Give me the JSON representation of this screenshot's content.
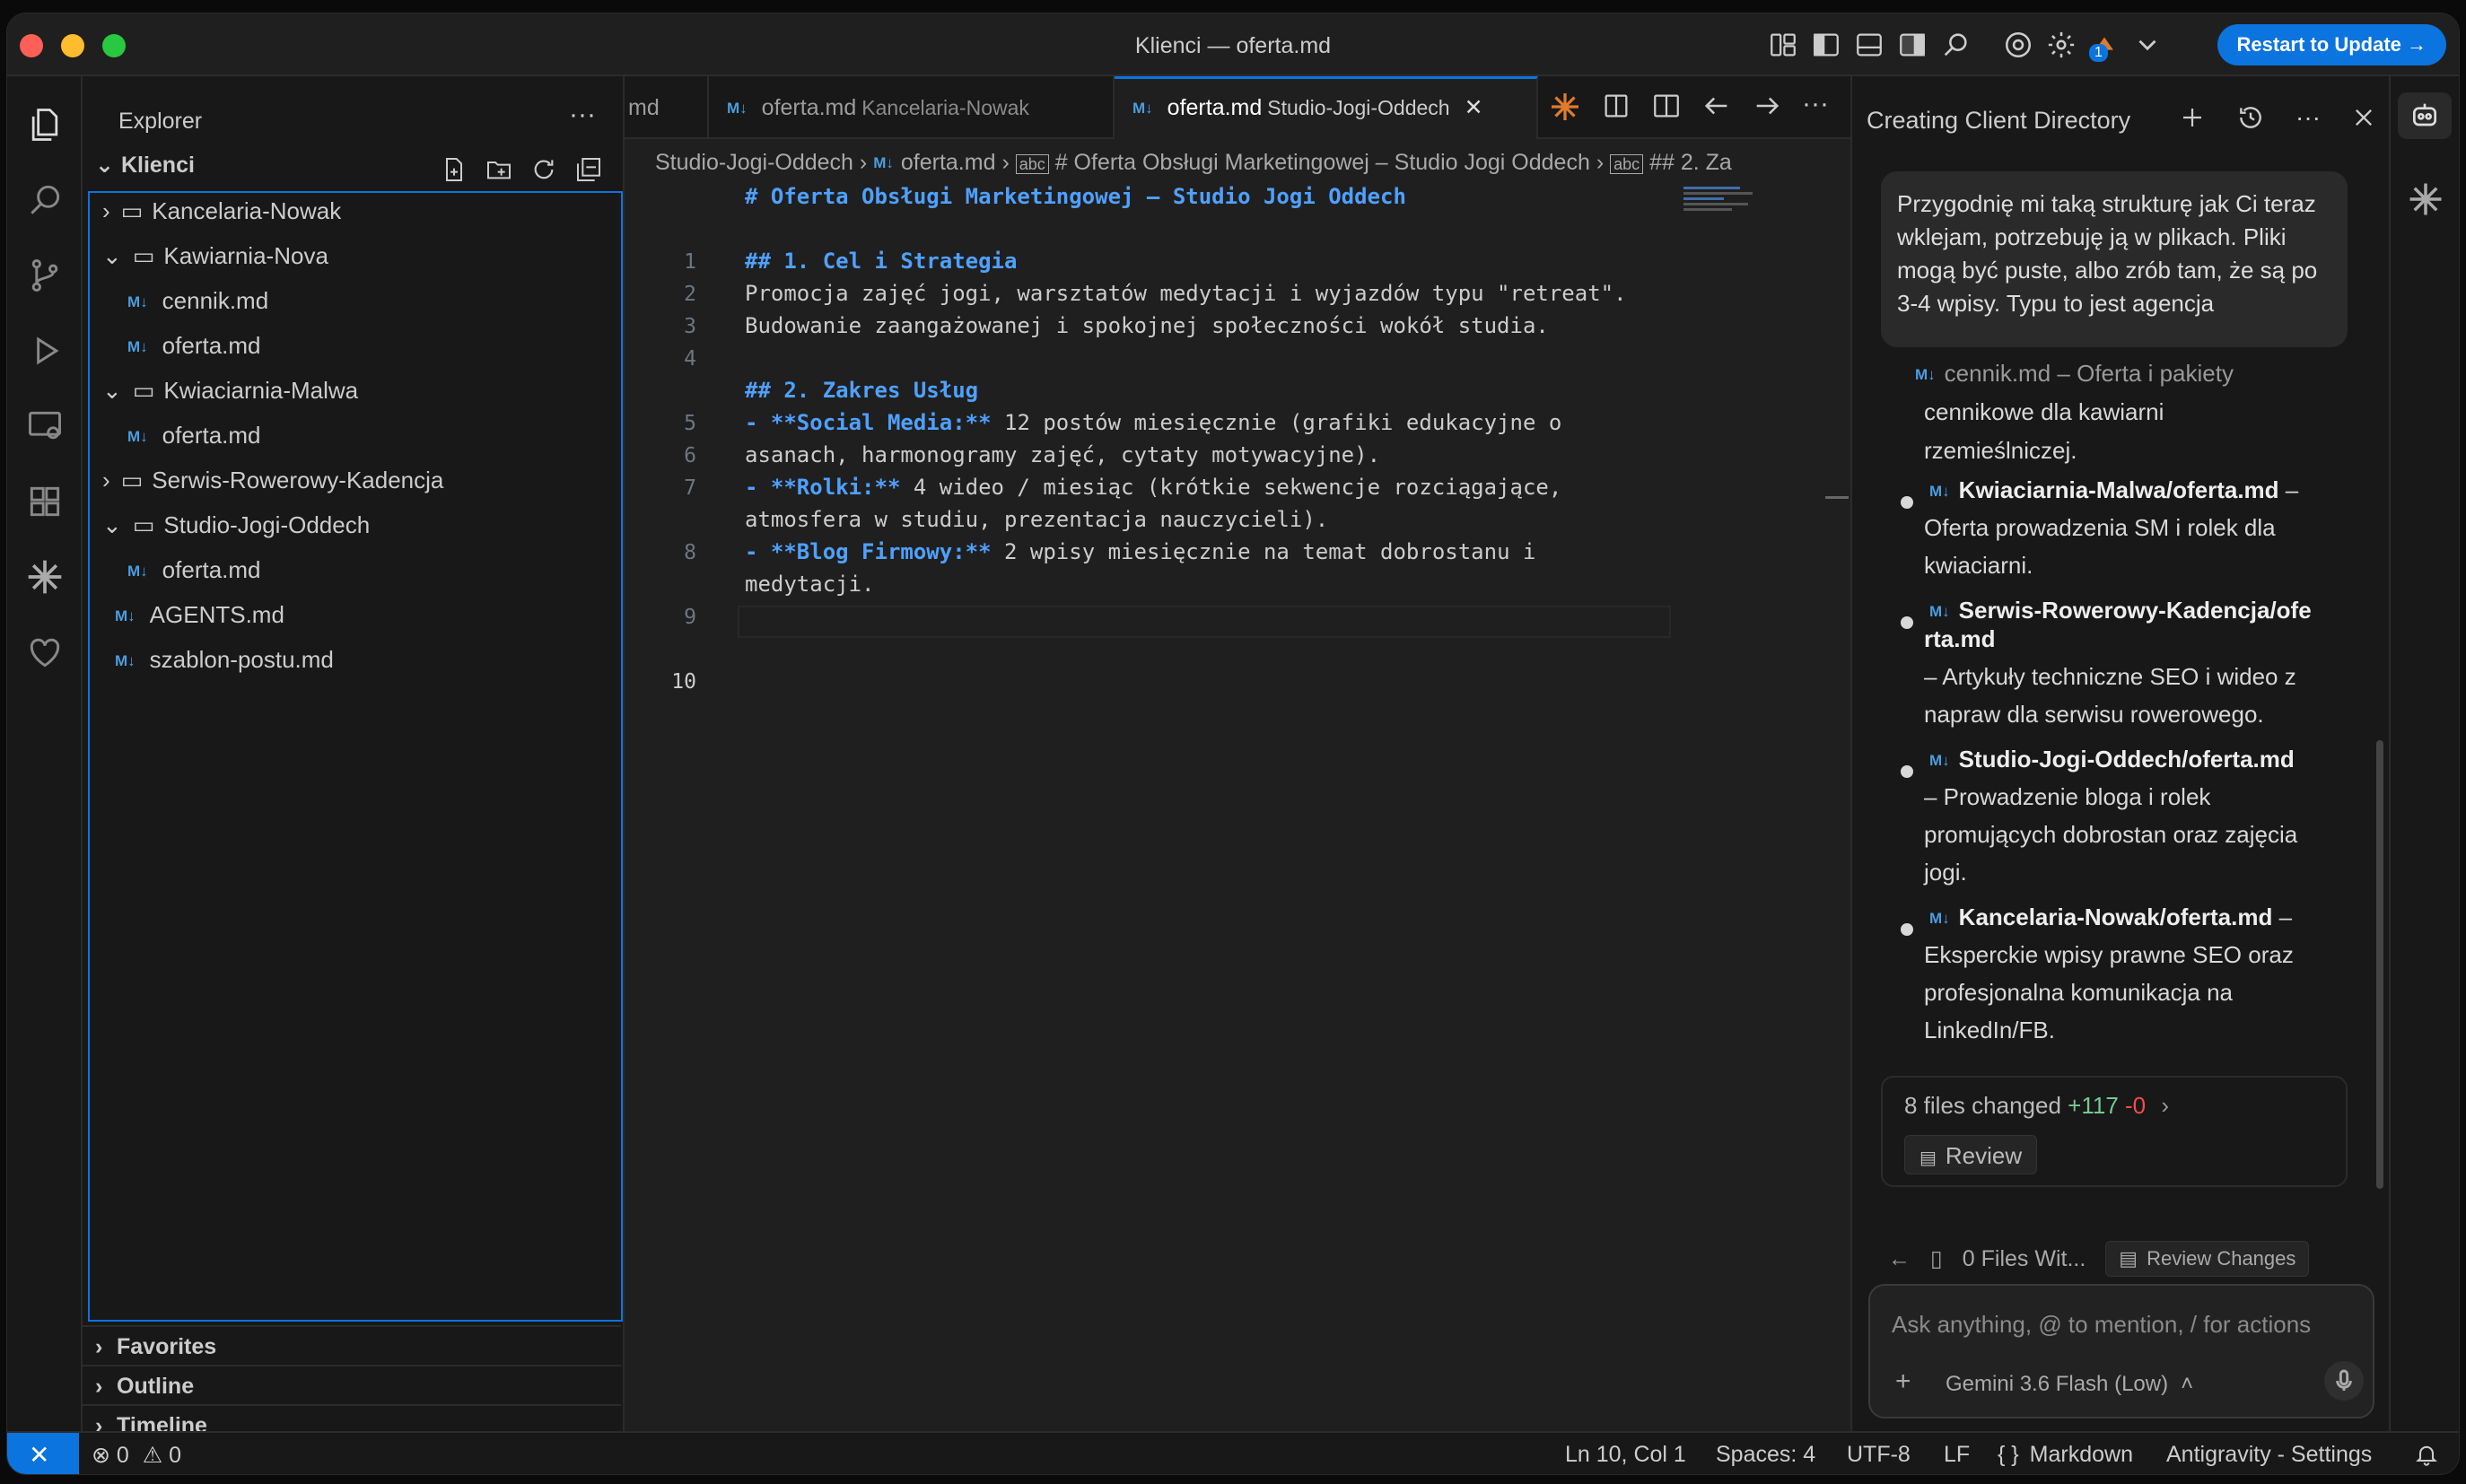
{
  "window": {
    "title": "Klienci — oferta.md"
  },
  "titlebar": {
    "restart_label": "Restart to Update →",
    "badge": "1"
  },
  "explorer": {
    "title": "Explorer",
    "root": "Klienci",
    "items": [
      {
        "label": "Kancelaria-Nowak",
        "type": "folder",
        "expanded": false
      },
      {
        "label": "Kawiarnia-Nova",
        "type": "folder",
        "expanded": true
      },
      {
        "label": "cennik.md",
        "type": "file"
      },
      {
        "label": "oferta.md",
        "type": "file"
      },
      {
        "label": "Kwiaciarnia-Malwa",
        "type": "folder",
        "expanded": true
      },
      {
        "label": "oferta.md",
        "type": "file"
      },
      {
        "label": "Serwis-Rowerowy-Kadencja",
        "type": "folder",
        "expanded": false
      },
      {
        "label": "Studio-Jogi-Oddech",
        "type": "folder",
        "expanded": true
      },
      {
        "label": "oferta.md",
        "type": "file"
      },
      {
        "label": "AGENTS.md",
        "type": "file"
      },
      {
        "label": "szablon-postu.md",
        "type": "file"
      }
    ],
    "md_badge": "M↓",
    "sections": {
      "favorites": "Favorites",
      "outline": "Outline",
      "timeline": "Timeline"
    }
  },
  "editor": {
    "tabs": [
      {
        "label": "md",
        "sub": ""
      },
      {
        "label": "oferta.md",
        "sub": "Kancelaria-Nowak"
      },
      {
        "label": "oferta.md",
        "sub": "Studio-Jogi-Oddech"
      }
    ],
    "breadcrumb": {
      "folder": "Studio-Jogi-Oddech",
      "file": "oferta.md",
      "h1": "# Oferta Obsługi Marketingowej – Studio Jogi Oddech",
      "h2": "## 2. Za"
    },
    "line_numbers": [
      "1",
      "2",
      "3",
      "4",
      "5",
      "6",
      "7",
      "8",
      "9",
      "10"
    ],
    "lines": {
      "l1": "# Oferta Obsługi Marketingowej – Studio Jogi Oddech",
      "l3": "## 1. Cel i Strategia",
      "l4a": "Promocja zajęć jogi, warsztatów medytacji i wyjazdów typu \"retreat\".",
      "l4b": "Budowanie zaangażowanej i spokojnej społeczności wokół studia.",
      "l6": "## 2. Zakres Usług",
      "l7a_b": "- **Social Media:**",
      "l7a_t": " 12 postów miesięcznie (grafiki edukacyjne o",
      "l7b": "asanach, harmonogramy zajęć, cytaty motywacyjne).",
      "l8a_b": "- **Rolki:**",
      "l8a_t": " 4 wideo / miesiąc (krótkie sekwencje rozciągające,",
      "l8b": "atmosfera w studiu, prezentacja nauczycieli).",
      "l9a_b": "- **Blog Firmowy:**",
      "l9a_t": " 2 wpisy miesięcznie na temat dobrostanu i",
      "l9b": "medytacji."
    }
  },
  "agent": {
    "title": "Creating Client Directory",
    "user_message": "Przygodnię mi taką strukturę jak Ci teraz wklejam, potrzebuję ją w plikach. Pliki mogą być puste, albo zrób tam, że są po 3-4 wpisy. Typu to jest agencja",
    "cennik_file": "cennik.md",
    "cennik_desc1": "– Oferta i pakiety",
    "cennik_desc2": "cennikowe dla kawiarni",
    "cennik_desc3": "rzemieślniczej.",
    "bullets": [
      {
        "file": "Kwiaciarnia-Malwa/oferta.md",
        "dash": " –",
        "desc": [
          "Oferta prowadzenia SM i rolek dla",
          "kwiaciarni."
        ]
      },
      {
        "file": "Serwis-Rowerowy-Kadencja/ofe",
        "file2": "rta.md",
        "desc": [
          "– Artykuły techniczne SEO i wideo z",
          "napraw dla serwisu rowerowego."
        ]
      },
      {
        "file": "Studio-Jogi-Oddech/oferta.md",
        "desc": [
          "– Prowadzenie bloga i rolek",
          "promujących dobrostan oraz zajęcia",
          "jogi."
        ]
      },
      {
        "file": "Kancelaria-Nowak/oferta.md",
        "dash": " –",
        "desc": [
          "Eksperckie wpisy prawne SEO oraz",
          "profesjonalna komunikacja na",
          "LinkedIn/FB."
        ]
      }
    ],
    "changes": {
      "summary": "8 files changed",
      "added": "+117",
      "removed": "-0",
      "review": "Review"
    },
    "files_with": "0 Files Wit...",
    "review_changes": "Review Changes",
    "input_placeholder": "Ask anything, @ to mention, / for actions",
    "model": "Gemini 3.6 Flash (Low)"
  },
  "status": {
    "errors": "0",
    "warnings": "0",
    "position": "Ln 10, Col 1",
    "spaces": "Spaces: 4",
    "encoding": "UTF-8",
    "eol": "LF",
    "language": "Markdown",
    "settings": "Antigravity - Settings"
  },
  "colors": {
    "accent": "#0b74de",
    "added": "#73c991",
    "removed": "#f14c4c",
    "heading": "#4fa0ff"
  }
}
